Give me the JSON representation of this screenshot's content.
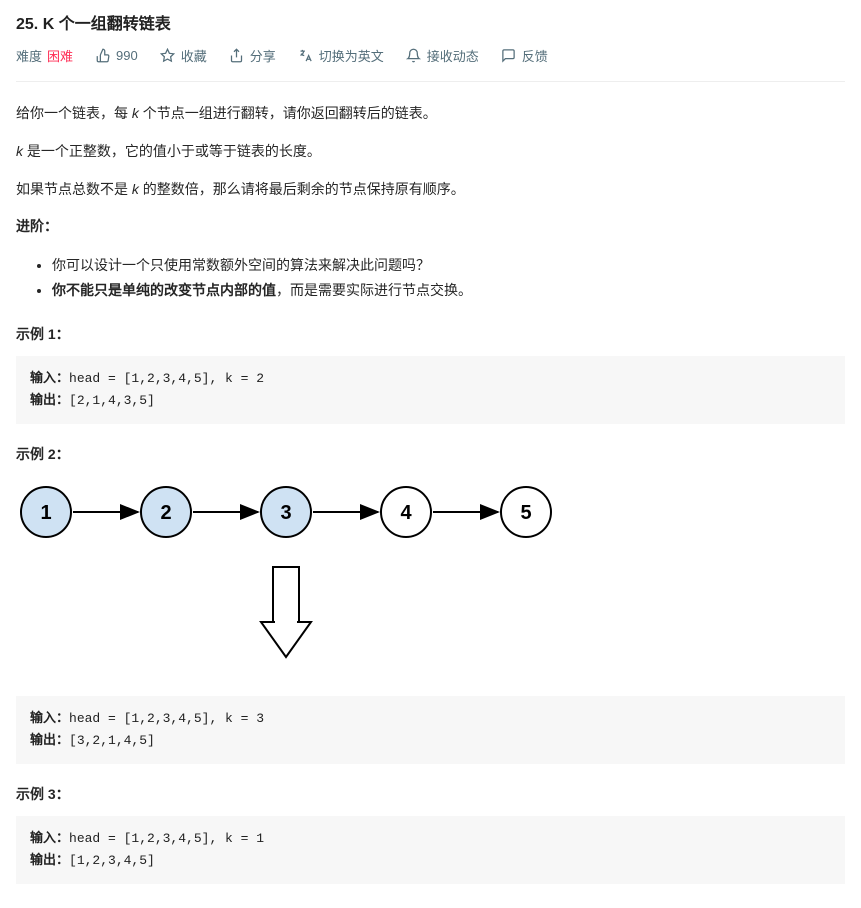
{
  "title": "25. K 个一组翻转链表",
  "meta": {
    "difficulty_label": "难度",
    "difficulty_value": "困难",
    "likes": "990",
    "favorite": "收藏",
    "share": "分享",
    "switch_lang": "切换为英文",
    "subscribe": "接收动态",
    "feedback": "反馈"
  },
  "desc": {
    "p1_a": "给你一个链表，每 ",
    "p1_k": "k",
    "p1_b": " 个节点一组进行翻转，请你返回翻转后的链表。",
    "p2_a": "k",
    "p2_b": " 是一个正整数，它的值小于或等于链表的长度。",
    "p3_a": "如果节点总数不是 ",
    "p3_k": "k",
    "p3_b": " 的整数倍，那么请将最后剩余的节点保持原有顺序。",
    "advanced": "进阶：",
    "li1": "你可以设计一个只使用常数额外空间的算法来解决此问题吗？",
    "li2_a": "你不能只是单纯的改变节点内部的值",
    "li2_b": "，而是需要实际进行节点交换。"
  },
  "examples": {
    "e1_label": "示例 1：",
    "e1_in_label": "输入：",
    "e1_in": "head = [1,2,3,4,5], k = 2",
    "e1_out_label": "输出：",
    "e1_out": "[2,1,4,3,5]",
    "e2_label": "示例 2：",
    "e2_in_label": "输入：",
    "e2_in": "head = [1,2,3,4,5], k = 3",
    "e2_out_label": "输出：",
    "e2_out": "[3,2,1,4,5]",
    "e3_label": "示例 3：",
    "e3_in_label": "输入：",
    "e3_in": "head = [1,2,3,4,5], k = 1",
    "e3_out_label": "输出：",
    "e3_out": "[1,2,3,4,5]"
  },
  "chart_data": {
    "type": "diagram",
    "description": "Linked list diagram for k=3 example",
    "nodes": [
      {
        "value": "1",
        "highlighted": true
      },
      {
        "value": "2",
        "highlighted": true
      },
      {
        "value": "3",
        "highlighted": true
      },
      {
        "value": "4",
        "highlighted": false
      },
      {
        "value": "5",
        "highlighted": false
      }
    ],
    "arrow_down_after_node_index": 2
  }
}
